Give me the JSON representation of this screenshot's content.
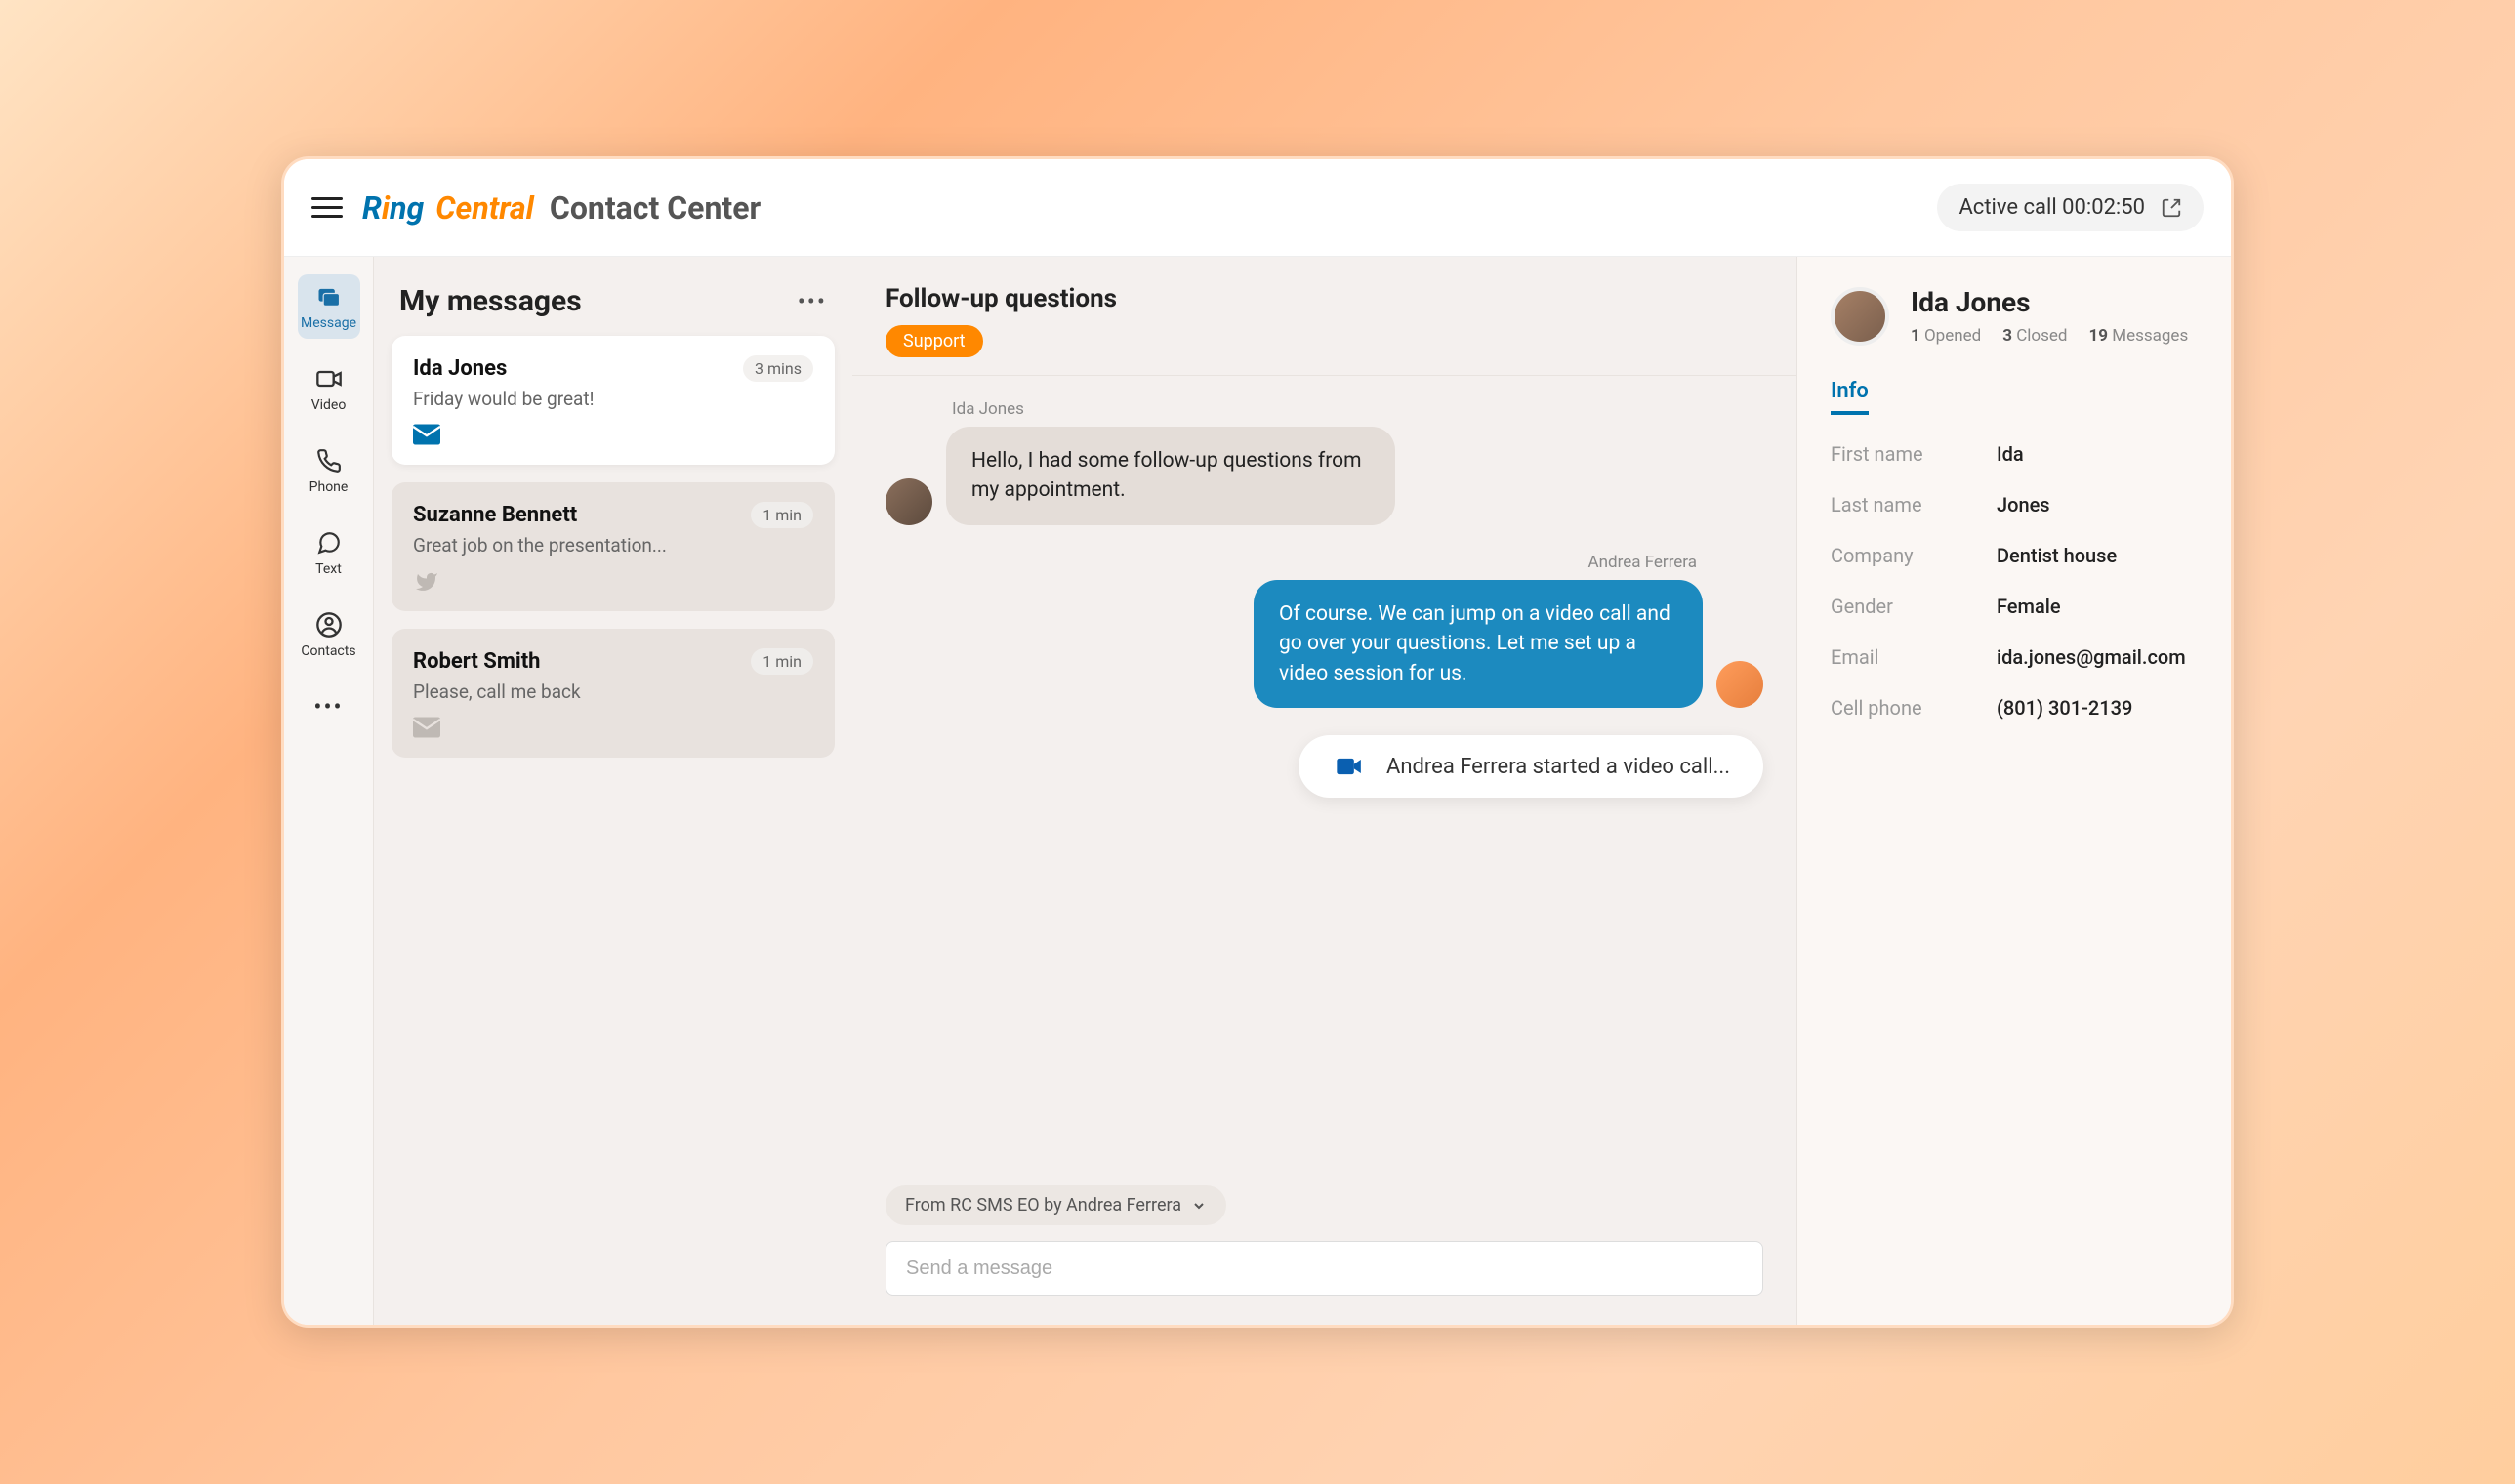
{
  "app": {
    "brand_ring": "Ring",
    "brand_central": "Central",
    "brand_subtitle": "Contact Center",
    "call_status": "Active call 00:02:50"
  },
  "nav": {
    "message": "Message",
    "video": "Video",
    "phone": "Phone",
    "text": "Text",
    "contacts": "Contacts"
  },
  "messages": {
    "title": "My messages",
    "items": [
      {
        "name": "Ida Jones",
        "preview": "Friday would be great!",
        "time": "3 mins",
        "channel": "email",
        "active": true
      },
      {
        "name": "Suzanne Bennett",
        "preview": "Great job on the presentation...",
        "time": "1 min",
        "channel": "twitter",
        "active": false
      },
      {
        "name": "Robert Smith",
        "preview": "Please, call me back",
        "time": "1 min",
        "channel": "email",
        "active": false
      }
    ]
  },
  "conversation": {
    "title": "Follow-up questions",
    "tag": "Support",
    "sender1": "Ida Jones",
    "bubble1": "Hello, I had some follow-up questions  from my appointment.",
    "sender2": "Andrea Ferrera",
    "bubble2": "Of course. We can jump on a video call and go over your questions. Let me set up a video session for us.",
    "video_notice": "Andrea Ferrera started a video call...",
    "source": "From RC SMS EO by Andrea Ferrera",
    "compose_placeholder": "Send a message"
  },
  "contact": {
    "name": "Ida Jones",
    "stats": {
      "opened_n": "1",
      "opened_l": "Opened",
      "closed_n": "3",
      "closed_l": "Closed",
      "msgs_n": "19",
      "msgs_l": "Messages"
    },
    "tab": "Info",
    "fields": {
      "first_name_l": "First name",
      "first_name_v": "Ida",
      "last_name_l": "Last name",
      "last_name_v": "Jones",
      "company_l": "Company",
      "company_v": "Dentist house",
      "gender_l": "Gender",
      "gender_v": "Female",
      "email_l": "Email",
      "email_v": "ida.jones@gmail.com",
      "cell_l": "Cell phone",
      "cell_v": "(801) 301-2139"
    }
  }
}
